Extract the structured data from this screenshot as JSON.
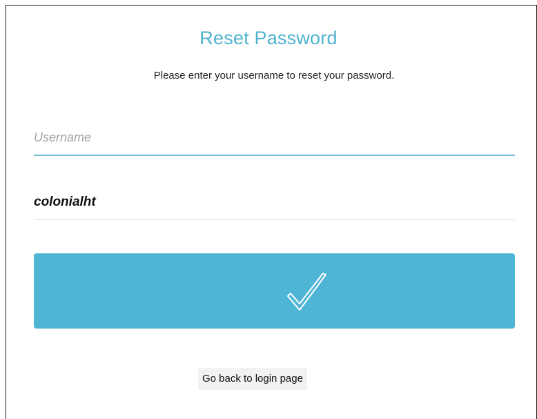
{
  "page": {
    "title": "Reset Password",
    "subtitle": "Please enter your username to reset your password."
  },
  "form": {
    "username_placeholder": "Username",
    "username_value": "",
    "entered_value": "colonialht",
    "submit_icon": "checkmark-icon"
  },
  "footer": {
    "back_link_label": "Go back to login page"
  },
  "colors": {
    "accent": "#4fb5d5",
    "title": "#4fb3cf",
    "underline": "#6cbcd4"
  }
}
